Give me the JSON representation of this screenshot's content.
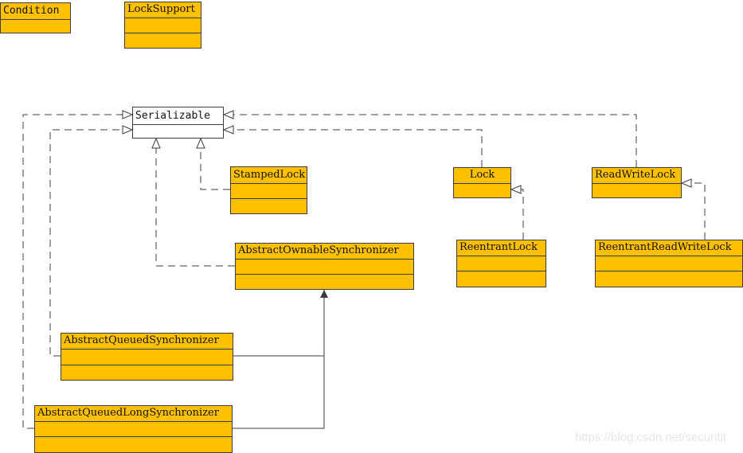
{
  "diagram": {
    "type": "UML class diagram",
    "classes": {
      "condition": {
        "name": "Condition",
        "compartments": 2,
        "fill": "#ffc000"
      },
      "lock_support": {
        "name": "LockSupport",
        "compartments": 3,
        "fill": "#ffc000"
      },
      "serializable": {
        "name": "Serializable",
        "compartments": 2,
        "fill": "#ffffff"
      },
      "stamped_lock": {
        "name": "StampedLock",
        "compartments": 3,
        "fill": "#ffc000"
      },
      "lock": {
        "name": "Lock",
        "compartments": 2,
        "fill": "#ffc000"
      },
      "read_write_lock": {
        "name": "ReadWriteLock",
        "compartments": 2,
        "fill": "#ffc000"
      },
      "reentrant_lock": {
        "name": "ReentrantLock",
        "compartments": 3,
        "fill": "#ffc000"
      },
      "reentrant_read_write_lock": {
        "name": "ReentrantReadWriteLock",
        "compartments": 3,
        "fill": "#ffc000"
      },
      "abstract_ownable_synchronizer": {
        "name": "AbstractOwnableSynchronizer",
        "compartments": 3,
        "fill": "#ffc000"
      },
      "abstract_queued_synchronizer": {
        "name": "AbstractQueuedSynchronizer",
        "compartments": 3,
        "fill": "#ffc000"
      },
      "abstract_queued_long_synchronizer": {
        "name": "AbstractQueuedLongSynchronizer",
        "compartments": 3,
        "fill": "#ffc000"
      }
    },
    "relationships": [
      {
        "from": "StampedLock",
        "to": "Serializable",
        "kind": "realization"
      },
      {
        "from": "AbstractOwnableSynchronizer",
        "to": "Serializable",
        "kind": "realization"
      },
      {
        "from": "AbstractQueuedSynchronizer",
        "to": "Serializable",
        "kind": "realization"
      },
      {
        "from": "AbstractQueuedLongSynchronizer",
        "to": "Serializable",
        "kind": "realization"
      },
      {
        "from": "Lock",
        "to": "Serializable",
        "kind": "realization"
      },
      {
        "from": "ReadWriteLock",
        "to": "Serializable",
        "kind": "realization"
      },
      {
        "from": "ReentrantLock",
        "to": "Lock",
        "kind": "realization"
      },
      {
        "from": "ReentrantReadWriteLock",
        "to": "ReadWriteLock",
        "kind": "realization"
      },
      {
        "from": "AbstractQueuedSynchronizer",
        "to": "AbstractOwnableSynchronizer",
        "kind": "association"
      },
      {
        "from": "AbstractQueuedLongSynchronizer",
        "to": "AbstractOwnableSynchronizer",
        "kind": "association"
      }
    ],
    "colors": {
      "class_fill": "#ffc000",
      "interface_fill": "#ffffff",
      "line": "#3c3c3c",
      "watermark": "#e6e6e6"
    }
  },
  "watermark": "https://blog.csdn.net/securitit"
}
